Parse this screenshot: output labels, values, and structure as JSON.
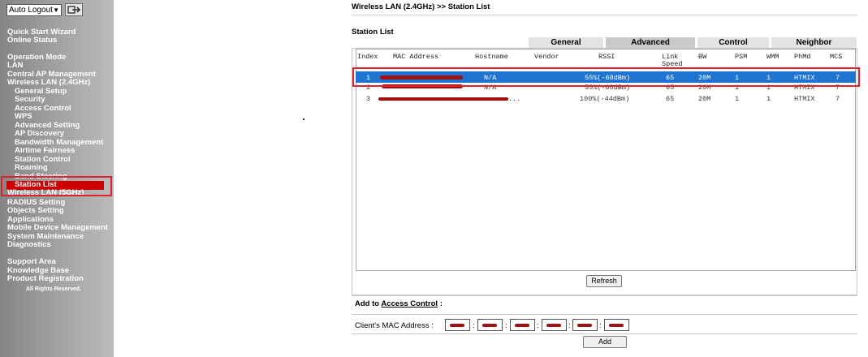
{
  "sidebar": {
    "logout_select": "Auto Logout",
    "items": [
      {
        "label": "Quick Start Wizard"
      },
      {
        "label": "Online Status"
      },
      {
        "label": "Operation Mode"
      },
      {
        "label": "LAN"
      },
      {
        "label": "Central AP Management"
      },
      {
        "label": "Wireless LAN (2.4GHz)"
      },
      {
        "label": "General Setup"
      },
      {
        "label": "Security"
      },
      {
        "label": "Access Control"
      },
      {
        "label": "WPS"
      },
      {
        "label": "Advanced Setting"
      },
      {
        "label": "AP Discovery"
      },
      {
        "label": "Bandwidth Management"
      },
      {
        "label": "Airtime Fairness"
      },
      {
        "label": "Station Control"
      },
      {
        "label": "Roaming"
      },
      {
        "label": "Band Steering"
      },
      {
        "label": "Station List"
      },
      {
        "label": "Wireless LAN (5GHz)"
      },
      {
        "label": "RADIUS Setting"
      },
      {
        "label": "Objects Setting"
      },
      {
        "label": "Applications"
      },
      {
        "label": "Mobile Device Management"
      },
      {
        "label": "System Maintenance"
      },
      {
        "label": "Diagnostics"
      },
      {
        "label": "Support Area"
      },
      {
        "label": "Knowledge Base"
      },
      {
        "label": "Product Registration"
      }
    ],
    "copyright": "All Rights Reserved."
  },
  "main": {
    "page_title": "Wireless LAN (2.4GHz) >> Station List",
    "section_title": "Station List",
    "tabs": [
      {
        "label": "General"
      },
      {
        "label": "Advanced"
      },
      {
        "label": "Control"
      },
      {
        "label": "Neighbor"
      }
    ],
    "columns": [
      "Index",
      "MAC Address",
      "Hostname",
      "Vendor",
      "RSSI",
      "Link",
      "Speed",
      "BW",
      "PSM",
      "WMM",
      "PhMd",
      "MCS"
    ],
    "rows": [
      {
        "index": "1",
        "hostname": "N/A",
        "rssi": "55%(-68dBm)",
        "speed": "65",
        "bw": "20M",
        "psm": "1",
        "wmm": "1",
        "phmd": "HTMIX",
        "mcs": "7"
      },
      {
        "index": "2",
        "hostname": "N/A",
        "rssi": "55%(-68dBm)",
        "speed": "65",
        "bw": "20M",
        "psm": "1",
        "wmm": "1",
        "phmd": "HTMIX",
        "mcs": "7"
      },
      {
        "index": "3",
        "hostname": "...",
        "rssi": "100%(-44dBm)",
        "speed": "65",
        "bw": "20M",
        "psm": "1",
        "wmm": "1",
        "phmd": "HTMIX",
        "mcs": "7"
      }
    ],
    "refresh_label": "Refresh",
    "add_to_prefix": "Add to",
    "add_to_link": "Access Control",
    "add_to_suffix": " :",
    "mac_label": "Client's MAC Address :",
    "add_label": "Add"
  },
  "colors": {
    "selected_row": "#1e74d0",
    "highlight_box": "#e0202a",
    "nav_selected": "#cc0000"
  }
}
